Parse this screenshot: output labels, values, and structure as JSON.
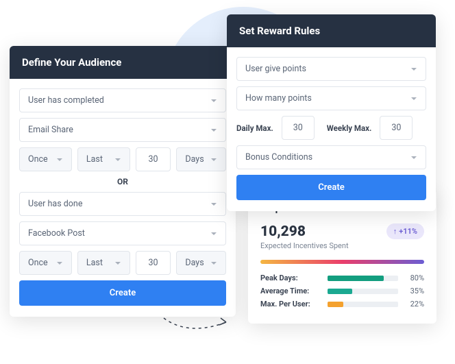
{
  "audience": {
    "title": "Define Your Audience",
    "block1": {
      "condition": "User has completed",
      "event": "Email Share",
      "freq": "Once",
      "period": "Last",
      "count": "30",
      "unit": "Days"
    },
    "separator": "OR",
    "block2": {
      "condition": "User has done",
      "event": "Facebook Post",
      "freq": "Once",
      "period": "Last",
      "count": "30",
      "unit": "Days"
    },
    "submit": "Create"
  },
  "reward": {
    "title": "Set Reward Rules",
    "action": "User give points",
    "amount": "How many points",
    "daily_label": "Daily Max.",
    "daily_value": "30",
    "weekly_label": "Weekly Max.",
    "weekly_value": "30",
    "bonus": "Bonus Conditions",
    "submit": "Create"
  },
  "prediction": {
    "title": "Step 3 - Prediction",
    "value": "10,298",
    "subtitle": "Expected Incentives Spent",
    "delta": "+11%",
    "stats": [
      {
        "label": "Peak Days:",
        "pct": 80,
        "color": "green"
      },
      {
        "label": "Average Time:",
        "pct": 35,
        "color": "teal"
      },
      {
        "label": "Max. Per User:",
        "pct": 22,
        "color": "orange"
      }
    ]
  }
}
